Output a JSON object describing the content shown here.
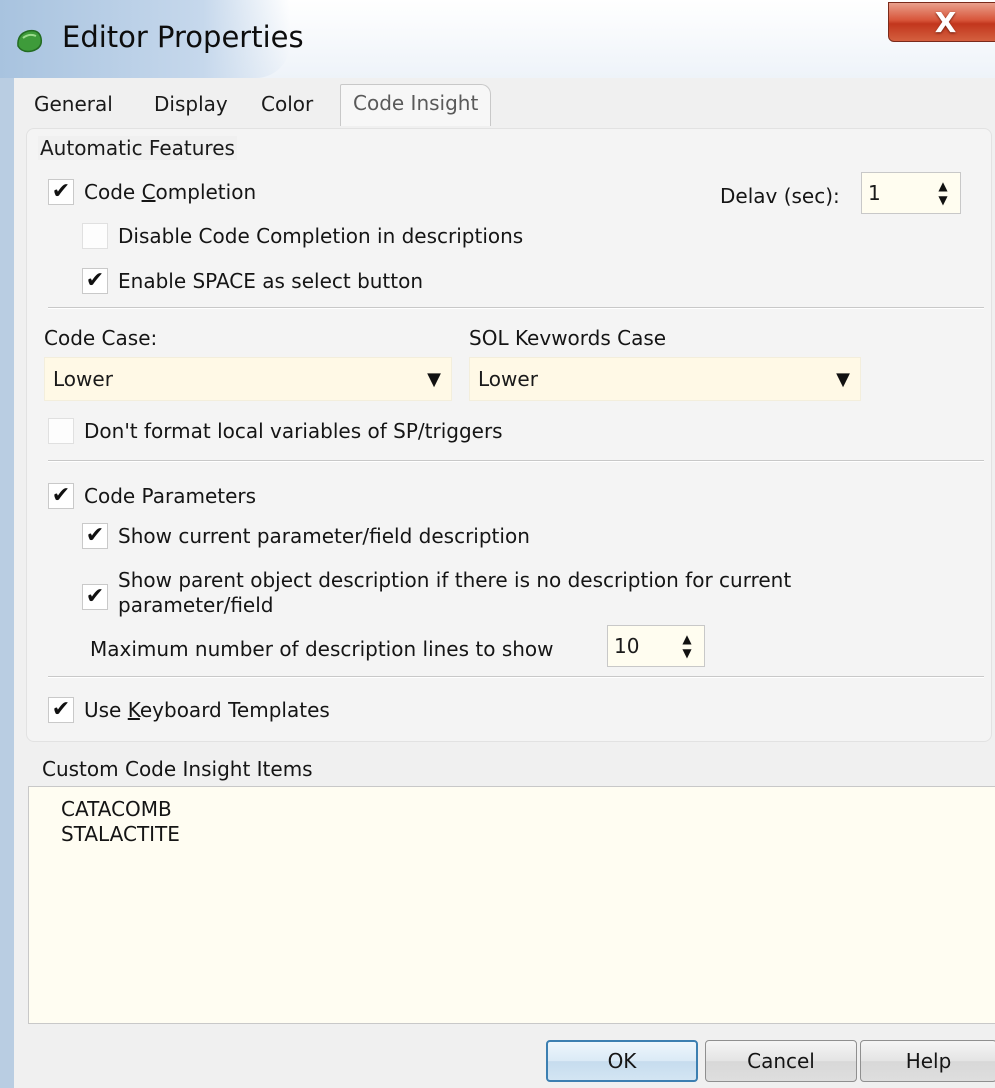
{
  "window": {
    "title": "Editor Properties"
  },
  "tabs": [
    {
      "label": "General"
    },
    {
      "label": "Display"
    },
    {
      "label": "Color"
    },
    {
      "label": "Code Insight",
      "active": true
    }
  ],
  "automatic_features": {
    "legend": "Automatic Features",
    "code_completion": {
      "label_pre": "Code ",
      "label_u": "C",
      "label_post": "ompletion",
      "checked": true
    },
    "delay": {
      "label": "Delav (sec):",
      "value": "1"
    },
    "disable_in_descriptions": {
      "label": "Disable Code Completion in descriptions",
      "checked": false
    },
    "enable_space": {
      "label": "Enable SPACE as select button",
      "checked": true
    },
    "code_case": {
      "label": "Code Case:",
      "value": "Lower"
    },
    "sql_keywords_case": {
      "label": "SOL Kevwords Case",
      "value": "Lower"
    },
    "dont_format_locals": {
      "label": "Don't format local variables of SP/triggers",
      "checked": false
    },
    "code_parameters": {
      "label": "Code Parameters",
      "checked": true
    },
    "show_current_param": {
      "label": "Show current parameter/field description",
      "checked": true
    },
    "show_parent_desc": {
      "label_line1": "Show parent object description if there is no description for current",
      "label_line2": "parameter/field",
      "checked": true
    },
    "max_lines": {
      "label": "Maximum number of description lines to show",
      "value": "10"
    },
    "keyboard_templates": {
      "label_pre": "Use ",
      "label_u": "K",
      "label_post": "eyboard Templates",
      "checked": true
    }
  },
  "custom_items": {
    "label": "Custom Code Insight Items",
    "items": [
      "CATACOMB",
      "STALACTITE"
    ]
  },
  "buttons": {
    "ok": "OK",
    "cancel": "Cancel",
    "help": "Help"
  },
  "icons": {
    "check": "✔",
    "close": "X",
    "spin_up": "▲",
    "spin_down": "▼",
    "dropdown": "▼"
  },
  "colors": {
    "accent": "#3c7fb1",
    "close_red": "#c2361d",
    "field_bg": "#fff9e6"
  }
}
